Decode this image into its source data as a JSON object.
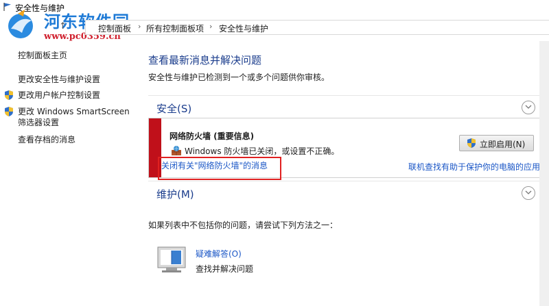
{
  "window": {
    "title": "安全性与维护",
    "icon": "flag-icon"
  },
  "watermark": {
    "title": "河东软件园",
    "url": "www.pc0359.cn"
  },
  "breadcrumb": {
    "items": [
      "控制面板",
      "所有控制面板项",
      "安全性与维护"
    ],
    "separator": "›"
  },
  "nav_arrows": "↑",
  "sidebar": {
    "home": "控制面板主页",
    "items": [
      {
        "label": "更改安全性与维护设置",
        "icon": ""
      },
      {
        "label": "更改用户帐户控制设置",
        "icon": "uac-shield-icon"
      },
      {
        "label_line1": "更改 Windows SmartScreen",
        "label_line2": "筛选器设置",
        "icon": "uac-shield-icon"
      },
      {
        "label": "查看存档的消息",
        "icon": ""
      }
    ]
  },
  "main": {
    "title": "查看最新消息并解决问题",
    "description": "安全性与维护已检测到一个或多个问题供你审核。",
    "security_section": "安全(S)",
    "maintenance_section": "维护(M)",
    "alert": {
      "title": "网络防火墙 (重要信息)",
      "message": "Windows 防火墙已关闭，或设置不正确。",
      "turn_off_link": "关闭有关\"网络防火墙\"的消息",
      "online_link": "联机查找有助于保护你的电脑的应用",
      "enable_button": "立即启用(N)",
      "accent_color": "#c0101a"
    },
    "troubleshoot": {
      "hint": "如果列表中不包括你的问题，请尝试下列方法之一：",
      "link": "疑难解答(O)",
      "desc": "查找并解决问题"
    }
  },
  "colors": {
    "link": "#1a56c6",
    "heading": "#1a3c8c",
    "highlight_box": "#e02020"
  }
}
